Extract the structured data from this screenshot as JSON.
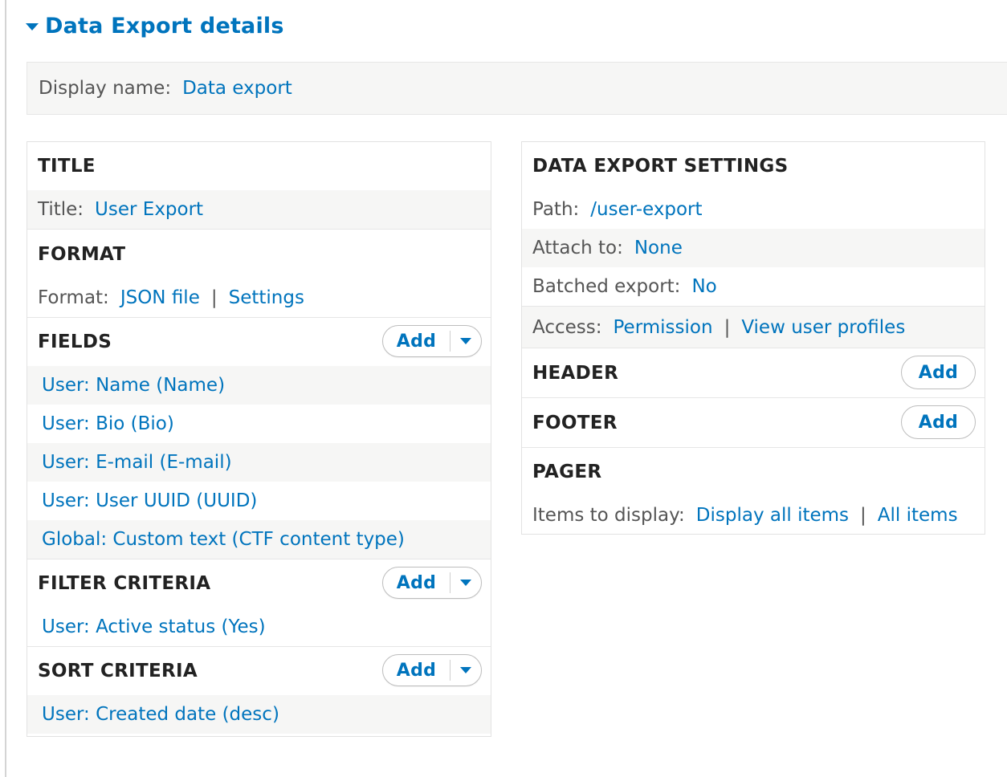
{
  "details": {
    "summary": "Data Export details"
  },
  "display": {
    "label": "Display name:",
    "value": "Data export"
  },
  "left": {
    "title": {
      "heading": "TITLE",
      "label": "Title:",
      "value": "User Export"
    },
    "format": {
      "heading": "FORMAT",
      "label": "Format:",
      "value": "JSON file",
      "separator": "|",
      "settings": "Settings"
    },
    "fields": {
      "heading": "FIELDS",
      "add": "Add",
      "items": [
        "User: Name (Name)",
        "User: Bio (Bio)",
        "User: E-mail (E-mail)",
        "User: User UUID (UUID)",
        "Global: Custom text (CTF content type)"
      ]
    },
    "filter": {
      "heading": "FILTER CRITERIA",
      "add": "Add",
      "items": [
        "User: Active status (Yes)"
      ]
    },
    "sort": {
      "heading": "SORT CRITERIA",
      "add": "Add",
      "items": [
        "User: Created date (desc)"
      ]
    }
  },
  "right": {
    "settings": {
      "heading": "DATA EXPORT SETTINGS",
      "path_label": "Path:",
      "path_value": "/user-export",
      "attach_label": "Attach to:",
      "attach_value": "None",
      "batched_label": "Batched export:",
      "batched_value": "No",
      "access_label": "Access:",
      "access_value": "Permission",
      "access_separator": "|",
      "access_value2": "View user profiles"
    },
    "header": {
      "heading": "HEADER",
      "add": "Add"
    },
    "footer": {
      "heading": "FOOTER",
      "add": "Add"
    },
    "pager": {
      "heading": "PAGER",
      "label": "Items to display:",
      "value": "Display all items",
      "separator": "|",
      "value2": "All items"
    }
  }
}
